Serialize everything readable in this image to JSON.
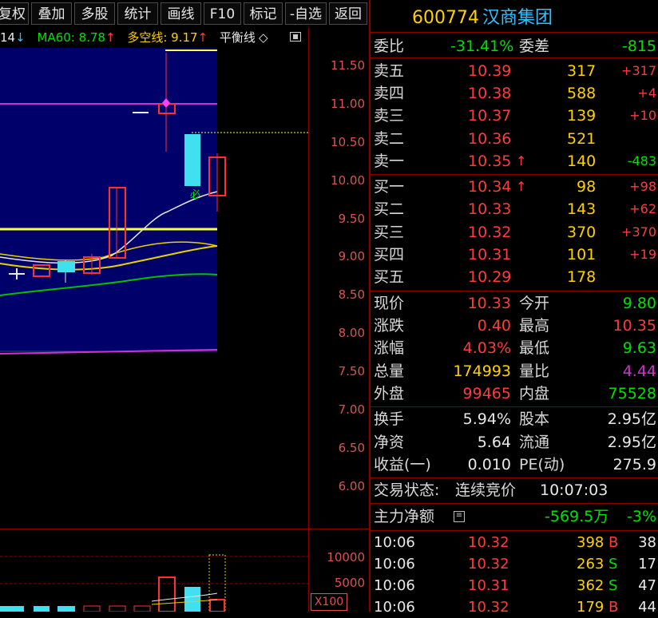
{
  "toolbar": {
    "buttons": [
      "复权",
      "叠加",
      "多股",
      "统计",
      "画线",
      "F10",
      "标记",
      "-自选",
      "返回"
    ]
  },
  "ma": {
    "ma_partial": "14",
    "ma_partial_arrow": "↓",
    "ma60_label": "MA60: 8.78",
    "ma60_arrow": "↑",
    "duokong_label": "多空线: 9.17",
    "duokong_arrow": "↑",
    "balance_label": "平衡线",
    "balance_icon": "◇"
  },
  "price_axis": [
    "11.50",
    "11.00",
    "10.50",
    "10.00",
    "9.50",
    "9.00",
    "8.50",
    "8.00",
    "7.50",
    "7.00",
    "6.50",
    "6.00"
  ],
  "volume_axis": [
    "10000",
    "5000"
  ],
  "volume_unit": "X100",
  "chart_marker": "必",
  "stock": {
    "code": "600774",
    "name": "汉商集团"
  },
  "weibi": {
    "label1": "委比",
    "value1": "-31.41%",
    "label2": "委差",
    "value2": "-815"
  },
  "sell": [
    {
      "label": "卖五",
      "price": "10.39",
      "vol": "317",
      "chg": "+317"
    },
    {
      "label": "卖四",
      "price": "10.38",
      "vol": "588",
      "chg": "+4"
    },
    {
      "label": "卖三",
      "price": "10.37",
      "vol": "139",
      "chg": "+10"
    },
    {
      "label": "卖二",
      "price": "10.36",
      "vol": "521",
      "chg": ""
    },
    {
      "label": "卖一",
      "price": "10.35",
      "vol": "140",
      "chg": "-483",
      "arrow": "↑"
    }
  ],
  "buy": [
    {
      "label": "买一",
      "price": "10.34",
      "vol": "98",
      "chg": "+98",
      "arrow": "↑"
    },
    {
      "label": "买二",
      "price": "10.33",
      "vol": "143",
      "chg": "+62"
    },
    {
      "label": "买三",
      "price": "10.32",
      "vol": "370",
      "chg": "+370"
    },
    {
      "label": "买四",
      "price": "10.31",
      "vol": "101",
      "chg": "+19"
    },
    {
      "label": "买五",
      "price": "10.29",
      "vol": "178",
      "chg": ""
    }
  ],
  "stats": [
    {
      "l1": "现价",
      "v1": "10.33",
      "l2": "今开",
      "v2": "9.80"
    },
    {
      "l1": "涨跌",
      "v1": "0.40",
      "l2": "最高",
      "v2": "10.35"
    },
    {
      "l1": "涨幅",
      "v1": "4.03%",
      "l2": "最低",
      "v2": "9.63"
    },
    {
      "l1": "总量",
      "v1": "174993",
      "l2": "量比",
      "v2": "4.44"
    },
    {
      "l1": "外盘",
      "v1": "99465",
      "l2": "内盘",
      "v2": "75528"
    }
  ],
  "fundamentals": [
    {
      "l1": "换手",
      "v1": "5.94%",
      "l2": "股本",
      "v2": "2.95亿"
    },
    {
      "l1": "净资",
      "v1": "5.64",
      "l2": "流通",
      "v2": "2.95亿"
    },
    {
      "l1": "收益(一)",
      "v1": "0.010",
      "l2": "PE(动)",
      "v2": "275.9"
    }
  ],
  "trade_status": {
    "label": "交易状态:",
    "value": "连续竞价",
    "time": "10:07:03"
  },
  "main_flow": {
    "label": "主力净额",
    "value": "-569.5万",
    "pct": "-3%"
  },
  "ticks": [
    {
      "time": "10:06",
      "price": "10.32",
      "vol": "398",
      "side": "B",
      "num": "38"
    },
    {
      "time": "10:06",
      "price": "10.32",
      "vol": "263",
      "side": "S",
      "num": "17"
    },
    {
      "time": "10:06",
      "price": "10.31",
      "vol": "362",
      "side": "S",
      "num": "47"
    },
    {
      "time": "10:06",
      "price": "10.32",
      "vol": "179",
      "side": "B",
      "num": "44"
    }
  ],
  "colors": {
    "up": "#ff3b3b",
    "down": "#00e000",
    "flat": "#e8e8e8",
    "accent": "#ffd000",
    "chart_bg": "#00006a",
    "grid_red": "#8b0000"
  }
}
